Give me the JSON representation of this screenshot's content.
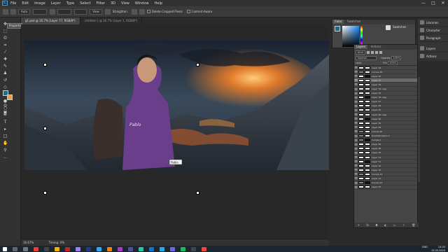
{
  "app": {
    "logo_label": "Ps"
  },
  "menu": [
    "File",
    "Edit",
    "Image",
    "Layer",
    "Type",
    "Select",
    "Filter",
    "3D",
    "View",
    "Window",
    "Help"
  ],
  "window_controls": [
    "—",
    "□",
    "✕"
  ],
  "options": {
    "auto_select": "Auto",
    "layer_dropdown": "Layer",
    "show_transform_label": "Show Transform Controls",
    "view_label": "View",
    "straighten_label": "Straighten",
    "delete_cropped_label": "Delete Cropped Pixels",
    "content_aware_label": "Content-Aware"
  },
  "tabs": [
    {
      "label": "g1.psd @ 16.7% (Layer 77, RGB/8*)",
      "active": true
    },
    {
      "label": "Untitled-1 @ 16.7% (Layer 1, RGB/8*)",
      "active": false
    }
  ],
  "tool_popup": {
    "label": "Properties"
  },
  "tools": [
    "move-tool-icon",
    "marquee-tool-icon",
    "lasso-tool-icon",
    "crop-tool-icon",
    "eyedropper-tool-icon",
    "healing-brush-icon",
    "brush-tool-icon",
    "clone-stamp-icon",
    "history-brush-icon",
    "eraser-tool-icon",
    "gradient-tool-icon",
    "blur-tool-icon",
    "dodge-tool-icon",
    "pen-tool-icon",
    "type-tool-icon",
    "path-selection-icon",
    "rectangle-tool-icon",
    "hand-tool-icon",
    "zoom-tool-icon"
  ],
  "colors": {
    "foreground": "#1f6b8a",
    "background": "#e8a040",
    "accent": "#31a8ff"
  },
  "color_panel": {
    "tabs": [
      "Color",
      "Swatches"
    ]
  },
  "properties_strip": {
    "items": [
      "Libraries",
      "Character",
      "Paragraph",
      "Layers",
      "Actions"
    ]
  },
  "layers_panel": {
    "tabs": [
      "Layers",
      "Actions"
    ],
    "filter_label": "Kind",
    "blend_mode": "Normal",
    "opacity_label": "Opacity:",
    "opacity_value": "100%",
    "fill_label": "Fill:",
    "fill_value": "100%",
    "lock_label": "Lock:",
    "layers": [
      "Layer 19",
      "Curves 18",
      "Layer 20",
      "Layer 77",
      "Layer 76",
      "Layer 79 copy",
      "Layer 79",
      "Layer 78 copy",
      "Layer 47",
      "Layer 46",
      "Layer 45",
      "Layer 40 copy",
      "Layer 40",
      "Layer 39",
      "Layer 38",
      "Curves 16",
      "Hue/Saturation 2",
      "Curves 2",
      "Layer 36",
      "Layer 36",
      "Layer 35",
      "Layer 72",
      "Layer 71",
      "Layer 16",
      "Layer 15",
      "Curves 14",
      "Layer 12",
      "Curves 13",
      "Layer 25"
    ],
    "selected_index": 3
  },
  "status": {
    "zoom": "16.67%",
    "doc": "Timing: 0%"
  },
  "taskbar": {
    "time": "14:33",
    "date": "13.05.2020",
    "lang": "ENG"
  },
  "canvas_overlay_text": "Pablo"
}
